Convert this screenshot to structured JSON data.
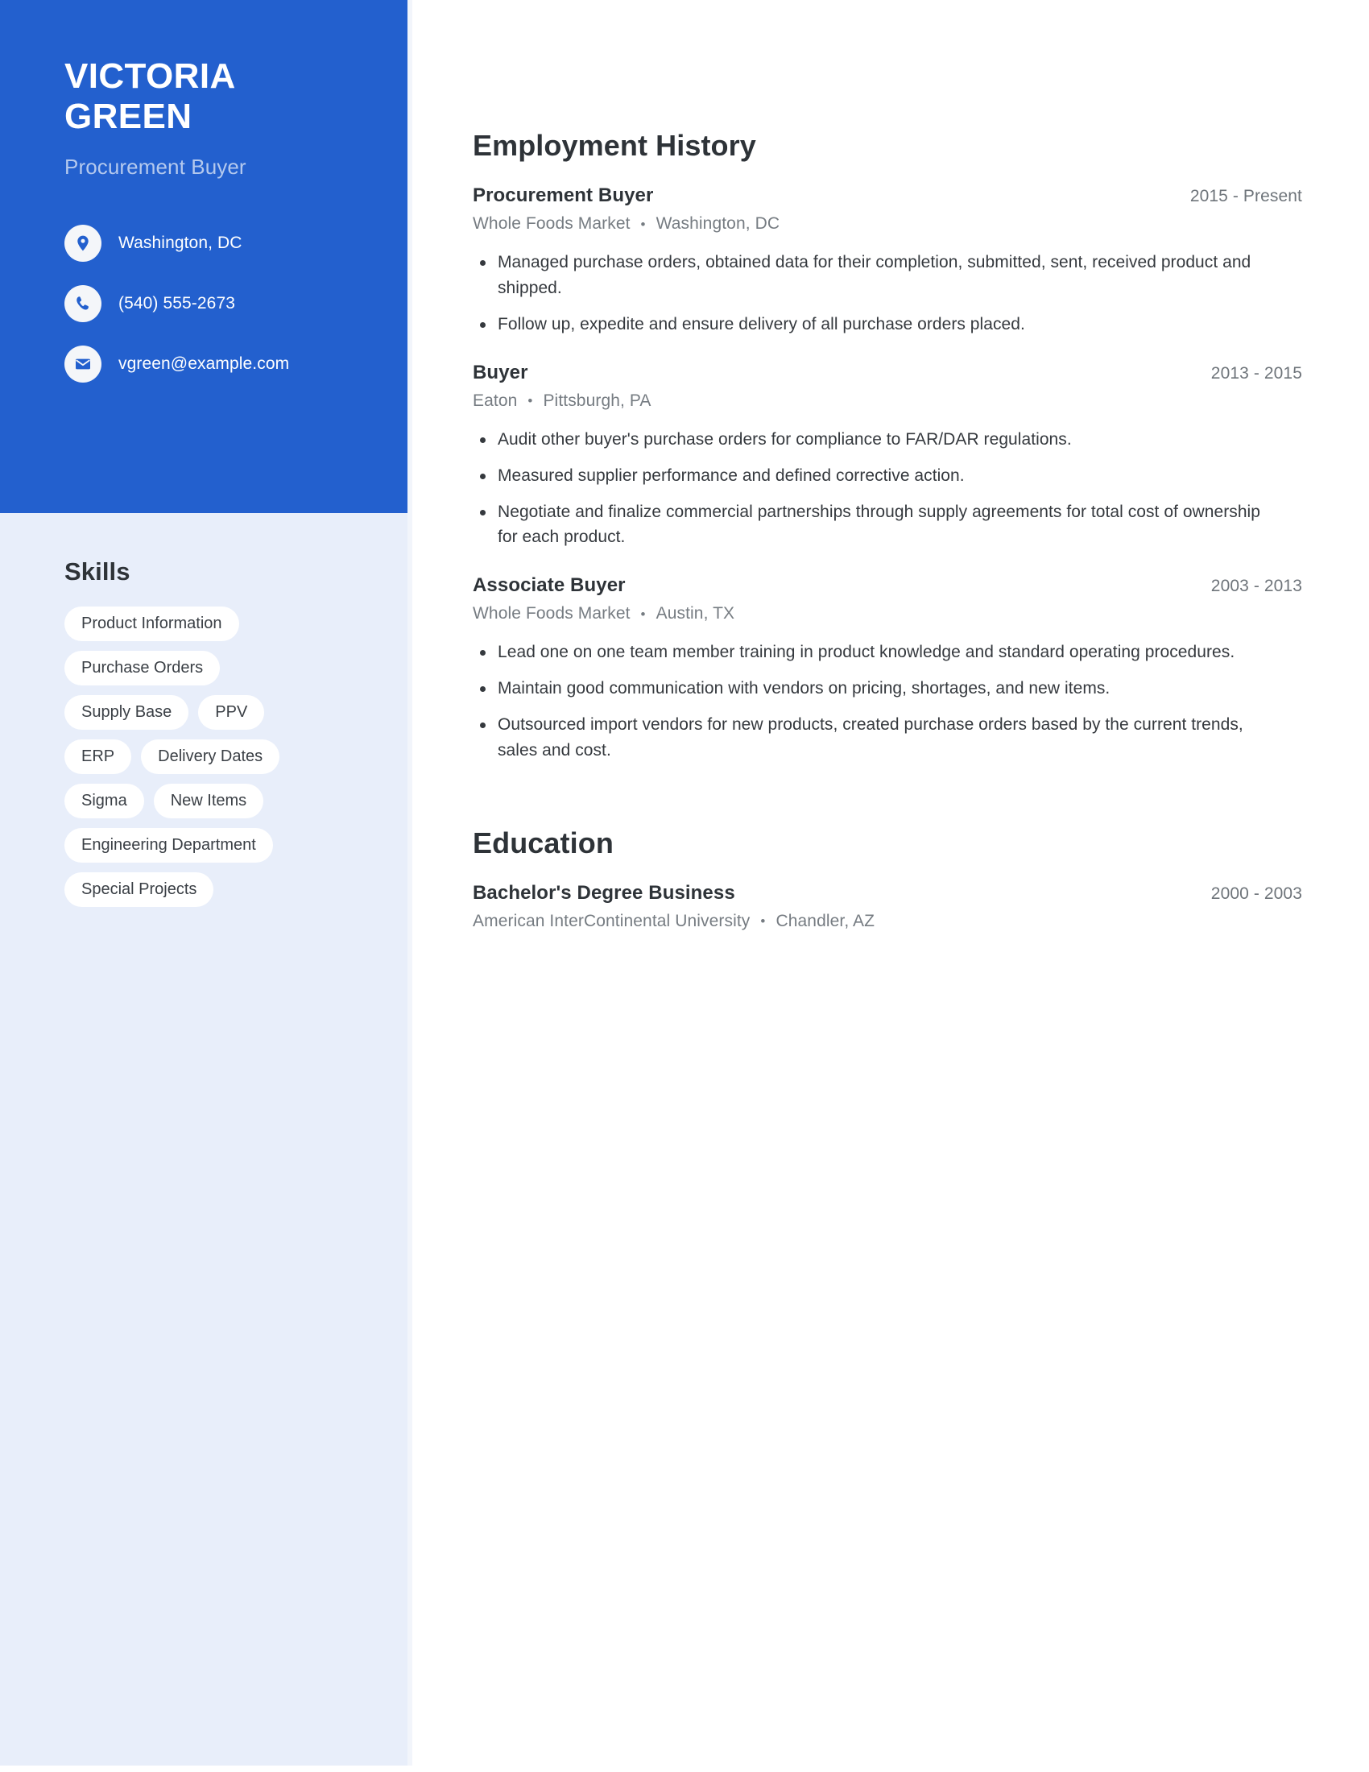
{
  "theme": {
    "accent": "#2360ce",
    "sidebar_bg": "#e8eefa",
    "tag_bg": "#ffffff",
    "heading_color": "#2e3338",
    "muted_text": "#767c82",
    "subtitle_color": "#b4c9ee"
  },
  "profile": {
    "name": "VICTORIA GREEN",
    "name_line1": "VICTORIA",
    "name_line2": "GREEN",
    "title": "Procurement Buyer"
  },
  "contact": [
    {
      "icon": "location-pin-icon",
      "label": "Washington, DC"
    },
    {
      "icon": "phone-icon",
      "label": "(540) 555-2673"
    },
    {
      "icon": "envelope-icon",
      "label": "vgreen@example.com"
    }
  ],
  "skills": {
    "heading": "Skills",
    "rows": [
      [
        "Product Information"
      ],
      [
        "Purchase Orders"
      ],
      [
        "Supply Base",
        "PPV"
      ],
      [
        "ERP",
        "Delivery Dates"
      ],
      [
        "Sigma",
        "New Items"
      ],
      [
        "Engineering Department"
      ],
      [
        "Special Projects"
      ]
    ]
  },
  "employment": {
    "heading": "Employment History",
    "entries": [
      {
        "role": "Procurement Buyer",
        "dates": "2015 - Present",
        "company": "Whole Foods Market",
        "location": "Washington, DC",
        "bullets": [
          "Managed purchase orders, obtained data for their completion, submitted, sent, received product and shipped.",
          "Follow up, expedite and ensure delivery of all purchase orders placed."
        ]
      },
      {
        "role": "Buyer",
        "dates": "2013 - 2015",
        "company": "Eaton",
        "location": "Pittsburgh, PA",
        "bullets": [
          "Audit other buyer's purchase orders for compliance to FAR/DAR regulations.",
          "Measured supplier performance and defined corrective action.",
          "Negotiate and finalize commercial partnerships through supply agreements for total cost of ownership for each product."
        ]
      },
      {
        "role": "Associate Buyer",
        "dates": "2003 - 2013",
        "company": "Whole Foods Market",
        "location": "Austin, TX",
        "bullets": [
          "Lead one on one team member training in product knowledge and standard operating procedures.",
          "Maintain good communication with vendors on pricing, shortages, and new items.",
          "Outsourced import vendors for new products, created purchase orders based by the current trends, sales and cost."
        ]
      }
    ]
  },
  "education": {
    "heading": "Education",
    "entries": [
      {
        "degree": "Bachelor's Degree Business",
        "dates": "2000 - 2003",
        "school": "American InterContinental University",
        "location": "Chandler, AZ"
      }
    ]
  },
  "separator": "•"
}
